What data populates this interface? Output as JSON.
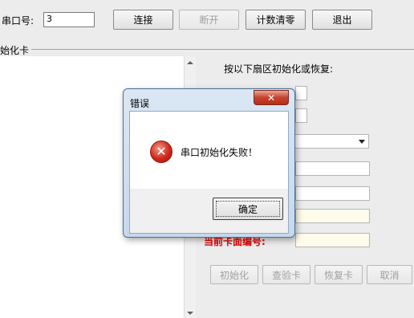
{
  "toolbar": {
    "port_label": "串口号:",
    "port_value": "3",
    "connect": "连接",
    "disconnect": "断开",
    "reset_count": "计数清零",
    "exit": "退出"
  },
  "group": {
    "title": "始化卡"
  },
  "right_panel": {
    "heading": "按以下扇区初始化或恢复:",
    "current_card_label": "当前卡面编号:",
    "buttons": {
      "init": "初始化",
      "check": "查验卡",
      "restore": "恢复卡",
      "cancel": "取消"
    }
  },
  "dialog": {
    "title": "错误",
    "close": "✕",
    "icon_glyph": "✕",
    "message": "串口初始化失败！",
    "ok": "确定"
  },
  "colors": {
    "label_red": "#e00000",
    "dialog_border": "#4d6f94"
  }
}
